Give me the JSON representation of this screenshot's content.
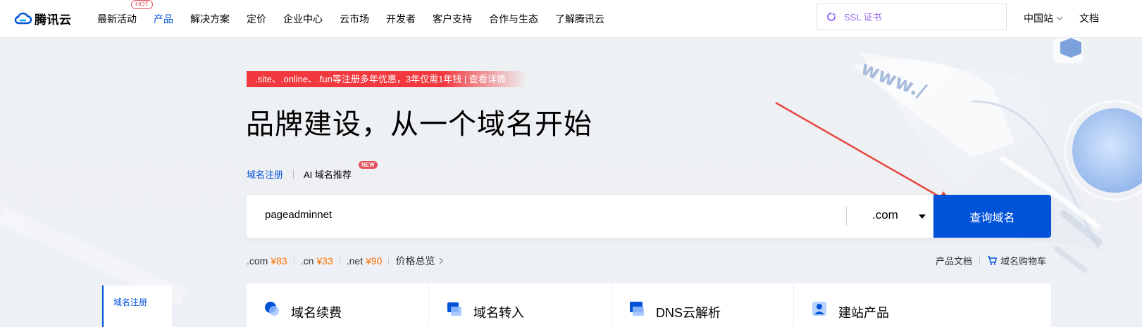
{
  "header": {
    "logo_text": "腾讯云",
    "nav": [
      {
        "label": "最新活动",
        "badge": "HOT"
      },
      {
        "label": "产品",
        "active": true
      },
      {
        "label": "解决方案"
      },
      {
        "label": "定价"
      },
      {
        "label": "企业中心"
      },
      {
        "label": "云市场"
      },
      {
        "label": "开发者"
      },
      {
        "label": "客户支持"
      },
      {
        "label": "合作与生态"
      },
      {
        "label": "了解腾讯云"
      }
    ],
    "search_placeholder": "SSL 证书",
    "region": "中国站",
    "docs": "文档"
  },
  "hero": {
    "promo": ".site、.online、.fun等注册多年优惠，3年仅需1年钱 | 查看详情",
    "headline": "品牌建设，从一个域名开始",
    "tabs": {
      "active": "域名注册",
      "ai": "AI 域名推荐",
      "ai_badge": "NEW"
    },
    "search": {
      "value": "pageadminnet",
      "suffix": ".com",
      "button": "查询域名"
    },
    "prices": [
      {
        "suffix": ".com",
        "price": "¥83"
      },
      {
        "suffix": ".cn",
        "price": "¥33"
      },
      {
        "suffix": ".net",
        "price": "¥90"
      }
    ],
    "overview": "价格总览",
    "links": {
      "docs": "产品文档",
      "cart": "域名购物车"
    }
  },
  "side_nav": {
    "active": "域名注册"
  },
  "services": [
    {
      "label": "域名续费",
      "icon": "renew-icon"
    },
    {
      "label": "域名转入",
      "icon": "transfer-icon"
    },
    {
      "label": "DNS云解析",
      "icon": "dns-icon"
    },
    {
      "label": "建站产品",
      "icon": "website-icon"
    }
  ],
  "colors": {
    "brand": "#0052d9",
    "promo": "#f0383e",
    "price": "#ff7200",
    "badge": "#e34d59",
    "annotation_arrow": "#e8463e"
  }
}
